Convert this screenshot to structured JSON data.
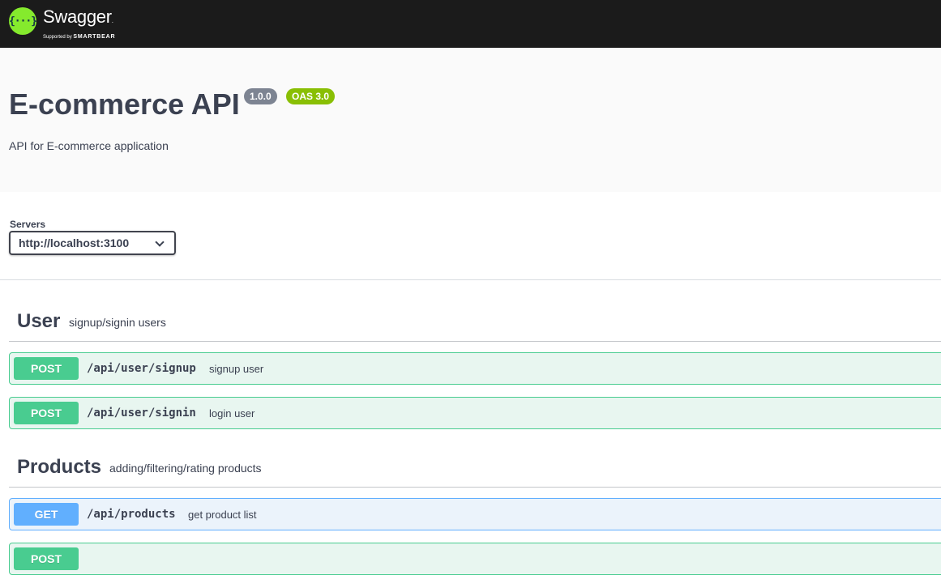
{
  "topbar": {
    "logo_glyph": "{···}",
    "logo_name": "Swagger",
    "logo_tm": ".",
    "logo_supported": "Supported by",
    "logo_brand": "SMARTBEAR"
  },
  "info": {
    "title": "E-commerce API",
    "version": "1.0.0",
    "oas": "OAS 3.0",
    "description": "API for E-commerce application"
  },
  "servers": {
    "label": "Servers",
    "selected": "http://localhost:3100"
  },
  "tags": [
    {
      "name": "User",
      "description": "signup/signin users",
      "operations": [
        {
          "method": "POST",
          "path": "/api/user/signup",
          "summary": "signup user"
        },
        {
          "method": "POST",
          "path": "/api/user/signin",
          "summary": "login user"
        }
      ]
    },
    {
      "name": "Products",
      "description": "adding/filtering/rating products",
      "operations": [
        {
          "method": "GET",
          "path": "/api/products",
          "summary": "get product list"
        },
        {
          "method": "POST",
          "path": "",
          "summary": ""
        }
      ]
    }
  ],
  "colors": {
    "post": "#49cc90",
    "get": "#61affe",
    "topbar": "#1b1b1b",
    "logo": "#85ea2d"
  }
}
